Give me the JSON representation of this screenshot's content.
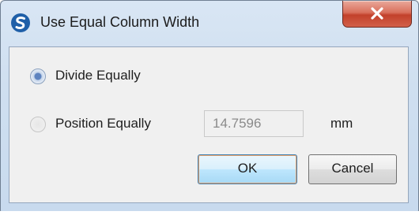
{
  "window": {
    "title": "Use Equal Column Width",
    "app_icon": "app-logo-icon",
    "close_icon": "close-icon"
  },
  "options": {
    "divide_label": "Divide Equally",
    "divide_selected": true,
    "position_label": "Position Equally",
    "position_selected": false,
    "position_enabled": false
  },
  "spacing": {
    "value": "14.7596",
    "unit": "mm"
  },
  "buttons": {
    "ok_label": "OK",
    "cancel_label": "Cancel"
  },
  "colors": {
    "close_button": "#c2412b",
    "selected_radio": "#5e83bf",
    "default_button_border": "#3c7fb1"
  }
}
